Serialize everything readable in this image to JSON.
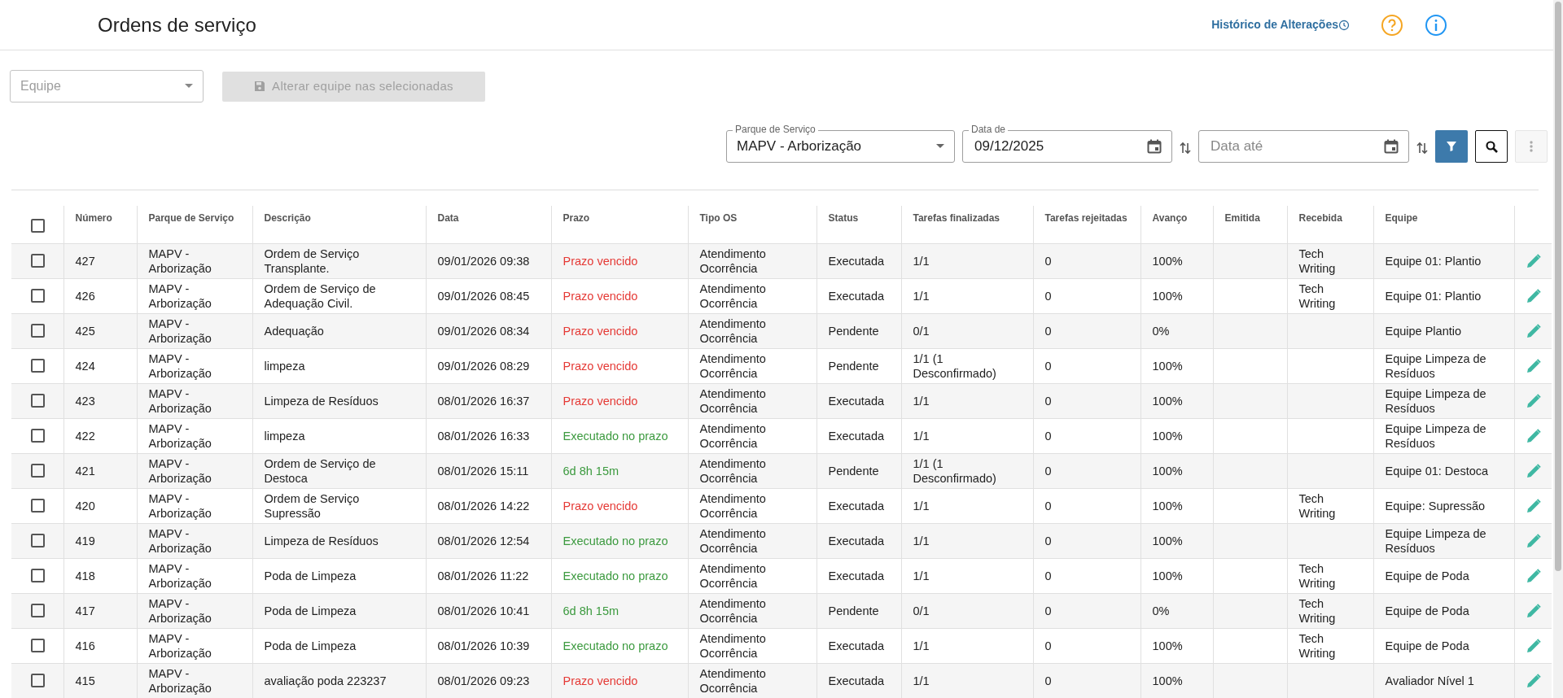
{
  "header": {
    "title": "Ordens de serviço",
    "history_link": "Histórico de Alterações"
  },
  "toolbar": {
    "team_select": {
      "placeholder": "Equipe"
    },
    "apply_button": {
      "label": "Alterar equipe nas selecionadas",
      "disabled": true
    }
  },
  "filters": {
    "service_park": {
      "label": "Parque de Serviço",
      "value": "MAPV - Arborização"
    },
    "date_from": {
      "label": "Data de",
      "value": "09/12/2025"
    },
    "date_to": {
      "placeholder": "Data até"
    },
    "filter_button": {
      "active": true
    },
    "more_button": {
      "disabled": true
    }
  },
  "table": {
    "select_all": {
      "checked": false
    },
    "columns": [
      "Número",
      "Parque de Serviço",
      "Descrição",
      "Data",
      "Prazo",
      "Tipo OS",
      "Status",
      "Tarefas finalizadas",
      "Tarefas rejeitadas",
      "Avanço",
      "Emitida",
      "Recebida",
      "Equipe"
    ],
    "rows": [
      {
        "checked": false,
        "number": "427",
        "park": "MAPV - Arborização",
        "description": "Ordem de Serviço Transplante.",
        "date": "09/01/2026 09:38",
        "deadline": {
          "text": "Prazo vencido",
          "kind": "overdue"
        },
        "type": "Atendimento Ocorrência",
        "status": "Executada",
        "done": "1/1",
        "rejected": "0",
        "progress": "100%",
        "received": "Tech Writing",
        "team": "Equipe 01: Plantio"
      },
      {
        "checked": false,
        "number": "426",
        "park": "MAPV - Arborização",
        "description": "Ordem de Serviço de Adequação Civil.",
        "date": "09/01/2026 08:45",
        "deadline": {
          "text": "Prazo vencido",
          "kind": "overdue"
        },
        "type": "Atendimento Ocorrência",
        "status": "Executada",
        "done": "1/1",
        "rejected": "0",
        "progress": "100%",
        "received": "Tech Writing",
        "team": "Equipe 01: Plantio"
      },
      {
        "checked": false,
        "number": "425",
        "park": "MAPV - Arborização",
        "description": "Adequação",
        "date": "09/01/2026 08:34",
        "deadline": {
          "text": "Prazo vencido",
          "kind": "overdue"
        },
        "type": "Atendimento Ocorrência",
        "status": "Pendente",
        "done": "0/1",
        "rejected": "0",
        "progress": "0%",
        "team": "Equipe Plantio"
      },
      {
        "checked": false,
        "number": "424",
        "park": "MAPV - Arborização",
        "description": "limpeza",
        "date": "09/01/2026 08:29",
        "deadline": {
          "text": "Prazo vencido",
          "kind": "overdue"
        },
        "type": "Atendimento Ocorrência",
        "status": "Pendente",
        "done": "1/1 (1 Desconfirmado)",
        "rejected": "0",
        "progress": "100%",
        "team": "Equipe Limpeza de Resíduos"
      },
      {
        "checked": false,
        "number": "423",
        "park": "MAPV - Arborização",
        "description": "Limpeza de Resíduos",
        "date": "08/01/2026 16:37",
        "deadline": {
          "text": "Prazo vencido",
          "kind": "overdue"
        },
        "type": "Atendimento Ocorrência",
        "status": "Executada",
        "done": "1/1",
        "rejected": "0",
        "progress": "100%",
        "team": "Equipe Limpeza de Resíduos"
      },
      {
        "checked": false,
        "number": "422",
        "park": "MAPV - Arborização",
        "description": "limpeza",
        "date": "08/01/2026 16:33",
        "deadline": {
          "text": "Executado no prazo",
          "kind": "ok"
        },
        "type": "Atendimento Ocorrência",
        "status": "Executada",
        "done": "1/1",
        "rejected": "0",
        "progress": "100%",
        "team": "Equipe Limpeza de Resíduos"
      },
      {
        "checked": false,
        "number": "421",
        "park": "MAPV - Arborização",
        "description": "Ordem de Serviço de Destoca",
        "date": "08/01/2026 15:11",
        "deadline": {
          "text": "6d 8h 15m",
          "kind": "ok"
        },
        "type": "Atendimento Ocorrência",
        "status": "Pendente",
        "done": "1/1 (1 Desconfirmado)",
        "rejected": "0",
        "progress": "100%",
        "team": "Equipe 01: Destoca"
      },
      {
        "checked": false,
        "number": "420",
        "park": "MAPV - Arborização",
        "description": "Ordem de Serviço Supressão",
        "date": "08/01/2026 14:22",
        "deadline": {
          "text": "Prazo vencido",
          "kind": "overdue"
        },
        "type": "Atendimento Ocorrência",
        "status": "Executada",
        "done": "1/1",
        "rejected": "0",
        "progress": "100%",
        "received": "Tech Writing",
        "team": "Equipe: Supressão"
      },
      {
        "checked": false,
        "number": "419",
        "park": "MAPV - Arborização",
        "description": "Limpeza de Resíduos",
        "date": "08/01/2026 12:54",
        "deadline": {
          "text": "Executado no prazo",
          "kind": "ok"
        },
        "type": "Atendimento Ocorrência",
        "status": "Executada",
        "done": "1/1",
        "rejected": "0",
        "progress": "100%",
        "team": "Equipe Limpeza de Resíduos"
      },
      {
        "checked": false,
        "number": "418",
        "park": "MAPV - Arborização",
        "description": "Poda de Limpeza",
        "date": "08/01/2026 11:22",
        "deadline": {
          "text": "Executado no prazo",
          "kind": "ok"
        },
        "type": "Atendimento Ocorrência",
        "status": "Executada",
        "done": "1/1",
        "rejected": "0",
        "progress": "100%",
        "received": "Tech Writing",
        "team": "Equipe de Poda"
      },
      {
        "checked": false,
        "number": "417",
        "park": "MAPV - Arborização",
        "description": "Poda de Limpeza",
        "date": "08/01/2026 10:41",
        "deadline": {
          "text": "6d 8h 15m",
          "kind": "ok"
        },
        "type": "Atendimento Ocorrência",
        "status": "Pendente",
        "done": "0/1",
        "rejected": "0",
        "progress": "0%",
        "received": "Tech Writing",
        "team": "Equipe de Poda"
      },
      {
        "checked": false,
        "number": "416",
        "park": "MAPV - Arborização",
        "description": "Poda de Limpeza",
        "date": "08/01/2026 10:39",
        "deadline": {
          "text": "Executado no prazo",
          "kind": "ok"
        },
        "type": "Atendimento Ocorrência",
        "status": "Executada",
        "done": "1/1",
        "rejected": "0",
        "progress": "100%",
        "received": "Tech Writing",
        "team": "Equipe de Poda"
      },
      {
        "checked": false,
        "number": "415",
        "park": "MAPV - Arborização",
        "description": "avaliação poda 223237",
        "date": "08/01/2026 09:23",
        "deadline": {
          "text": "Prazo vencido",
          "kind": "overdue"
        },
        "type": "Atendimento Ocorrência",
        "status": "Executada",
        "done": "1/1",
        "rejected": "0",
        "progress": "100%",
        "team": "Avaliador Nível 1"
      }
    ]
  }
}
